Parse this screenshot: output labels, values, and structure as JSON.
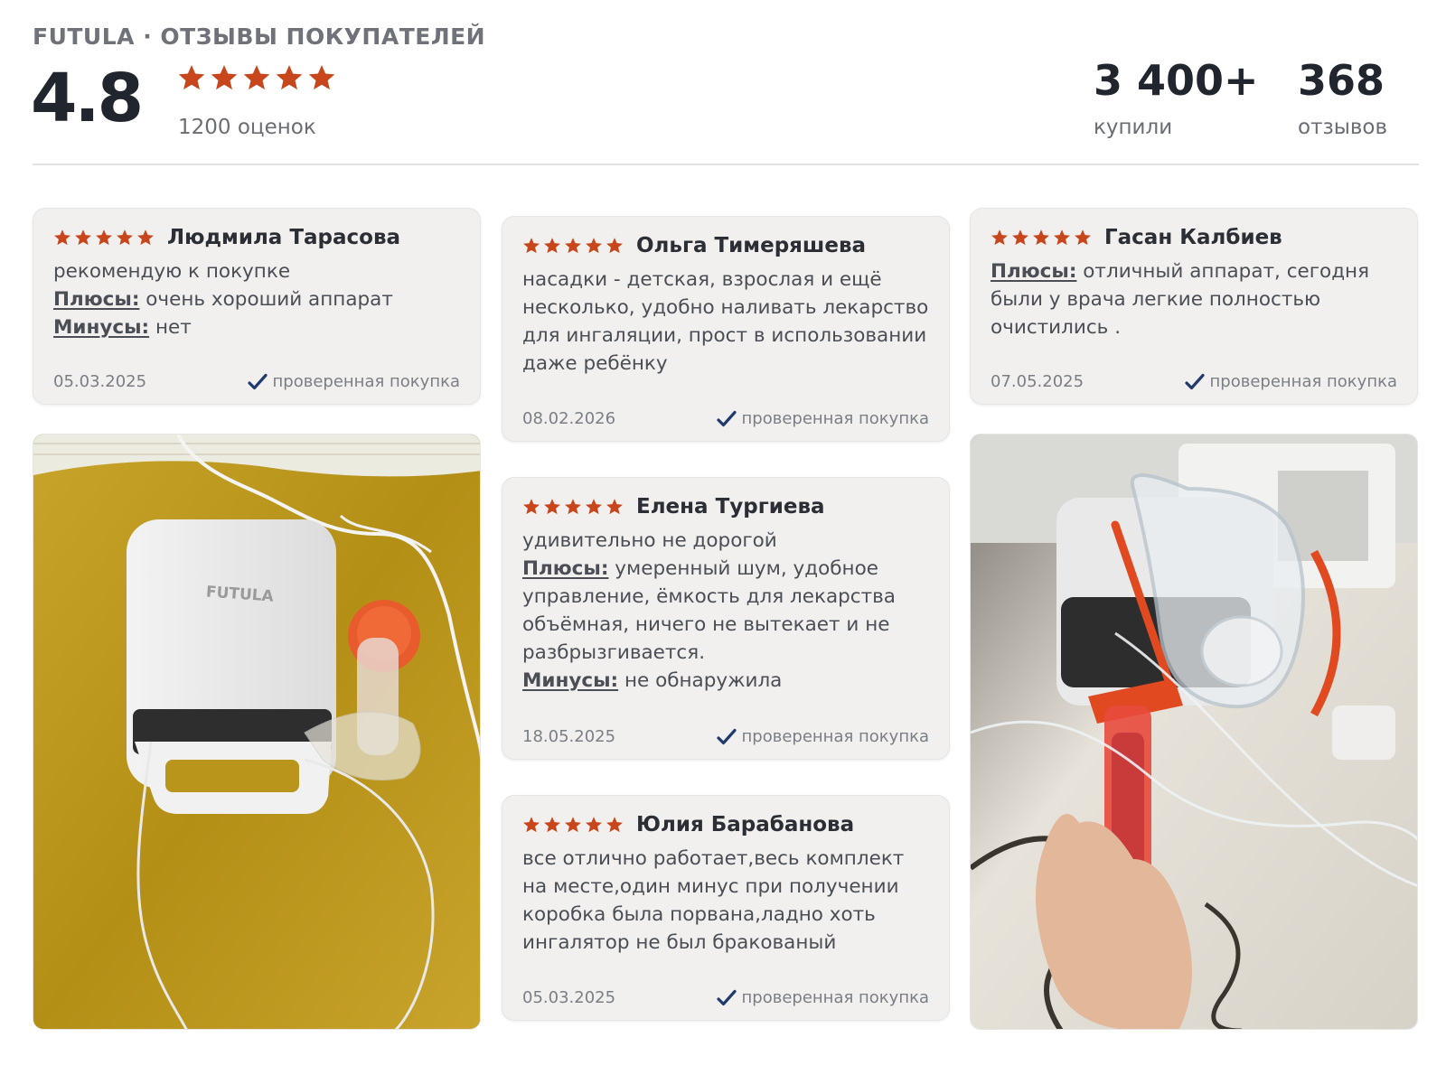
{
  "header": {
    "brand": "FUTULA · ОТЗЫВЫ ПОКУПАТЕЛЕЙ",
    "rating": "4.8",
    "rating_count": "1200 оценок",
    "stats": [
      {
        "value": "3 400+",
        "label": "купили"
      },
      {
        "value": "368",
        "label": "отзывов"
      }
    ]
  },
  "colors": {
    "star": "#c7461b",
    "check": "#1f3a6d",
    "card_bg": "#f1f0ef"
  },
  "reviews": [
    {
      "author": "Людмила Тарасова",
      "stars": 5,
      "comment": "рекомендую к покупке",
      "pros_label": "Плюсы:",
      "pros": "очень хороший аппарат",
      "cons_label": "Минусы:",
      "cons": "нет",
      "date": "05.03.2025",
      "verified": "проверенная покупка"
    },
    {
      "author": "Ольга Тимеряшева",
      "stars": 5,
      "comment": "насадки - детская, взрослая и ещё несколько, удобно наливать лекарство для ингаляции, прост в использовании даже ребёнку",
      "date": "08.02.2026",
      "verified": "проверенная покупка"
    },
    {
      "author": "Гасан Калбиев",
      "stars": 5,
      "pros_label": "Плюсы:",
      "pros": "отличный аппарат, сегодня были у врача легкие полностью очистились .",
      "date": "07.05.2025",
      "verified": "проверенная покупка"
    },
    {
      "author": "Елена Тургиева",
      "stars": 5,
      "comment": "удивительно не дорогой",
      "pros_label": "Плюсы:",
      "pros": "умеренный шум, удобное управление, ёмкость для лекарства объёмная, ничего не вытекает и не разбрызгивается.",
      "cons_label": "Минусы:",
      "cons": "не обнаружила",
      "date": "18.05.2025",
      "verified": "проверенная покупка"
    },
    {
      "author": "Юлия Барабанова",
      "stars": 5,
      "comment": "все отлично работает,весь комплект на месте,один минус при получении коробка была порвана,ладно хоть ингалятор не был бракованый",
      "date": "05.03.2025",
      "verified": "проверенная покупка"
    }
  ],
  "photos": {
    "left_device_text": "FUTULA"
  }
}
